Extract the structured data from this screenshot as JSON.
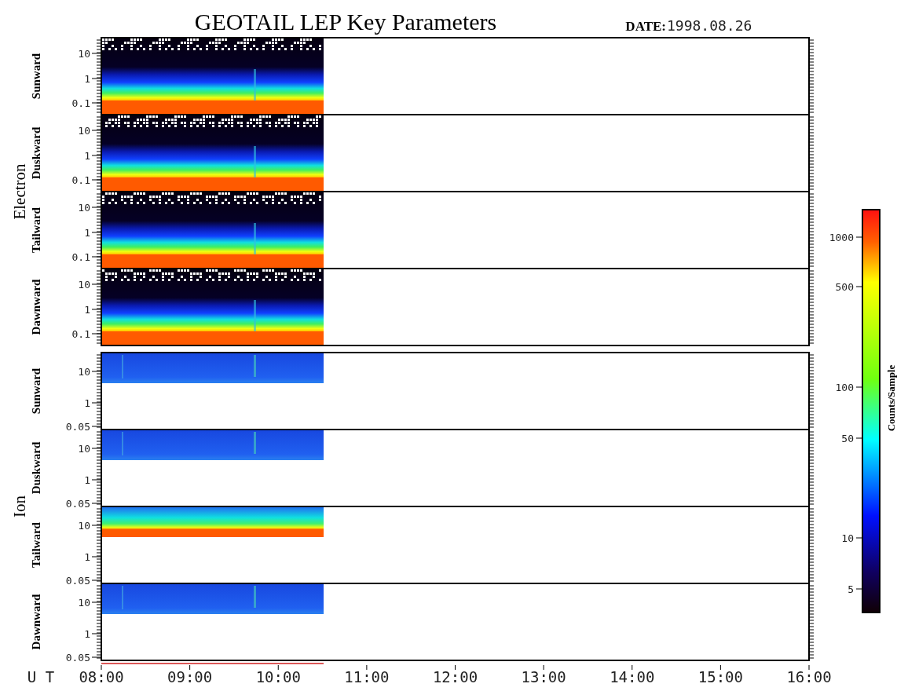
{
  "title": "GEOTAIL LEP Key Parameters",
  "date_label": "DATE:",
  "date": "1998.08.26",
  "groups": [
    {
      "label": "Electron",
      "panels": [
        {
          "direction": "Sunward",
          "kind": "electron",
          "ticks": [
            "10",
            "1",
            "0.1"
          ]
        },
        {
          "direction": "Duskward",
          "kind": "electron",
          "ticks": [
            "10",
            "1",
            "0.1"
          ]
        },
        {
          "direction": "Tailward",
          "kind": "electron",
          "ticks": [
            "10",
            "1",
            "0.1"
          ]
        },
        {
          "direction": "Dawnward",
          "kind": "electron",
          "ticks": [
            "10",
            "1",
            "0.1"
          ]
        }
      ]
    },
    {
      "label": "Ion",
      "panels": [
        {
          "direction": "Sunward",
          "kind": "ion-low",
          "ticks": [
            "10",
            "1",
            "0.05"
          ]
        },
        {
          "direction": "Duskward",
          "kind": "ion-low",
          "ticks": [
            "10",
            "1",
            "0.05"
          ]
        },
        {
          "direction": "Tailward",
          "kind": "ion-high",
          "ticks": [
            "10",
            "1",
            "0.05"
          ]
        },
        {
          "direction": "Dawnward",
          "kind": "ion-low",
          "ticks": [
            "10",
            "1",
            "0.05"
          ]
        }
      ]
    }
  ],
  "time_axis": {
    "label": "U T",
    "ticks": [
      "08:00",
      "09:00",
      "10:00",
      "11:00",
      "12:00",
      "13:00",
      "14:00",
      "15:00",
      "16:00"
    ]
  },
  "colorbar": {
    "title": "Counts/Sample",
    "ticks": [
      "1000",
      "500",
      "100",
      "50",
      "10",
      "5"
    ]
  }
}
